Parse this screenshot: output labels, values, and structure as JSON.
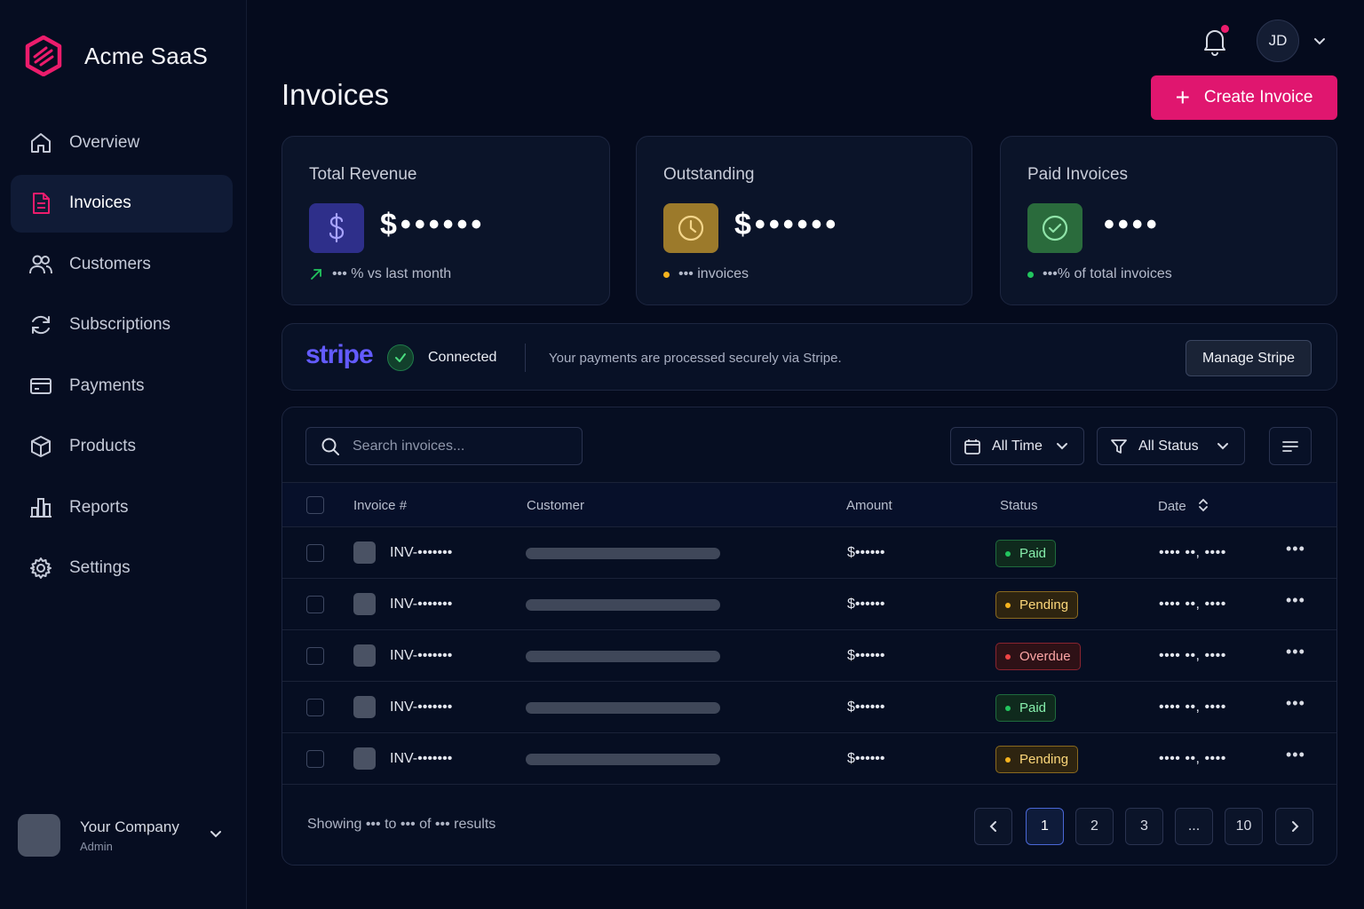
{
  "app": {
    "name": "Acme SaaS"
  },
  "colors": {
    "accent": "#e0166f",
    "paid": "#22c55e",
    "pending": "#f5b31e",
    "overdue": "#ef4444",
    "stripe": "#635bff"
  },
  "sidebar": {
    "items": [
      {
        "label": "Overview",
        "icon": "home-icon"
      },
      {
        "label": "Invoices",
        "icon": "file-icon",
        "active": true
      },
      {
        "label": "Customers",
        "icon": "users-icon"
      },
      {
        "label": "Subscriptions",
        "icon": "refresh-icon"
      },
      {
        "label": "Payments",
        "icon": "credit-card-icon"
      },
      {
        "label": "Products",
        "icon": "box-icon"
      },
      {
        "label": "Reports",
        "icon": "bar-chart-icon"
      },
      {
        "label": "Settings",
        "icon": "gear-icon"
      }
    ],
    "company": {
      "name": "Your Company",
      "role": "Admin"
    }
  },
  "header": {
    "title": "Invoices",
    "avatar_initials": "JD",
    "create_label": "Create Invoice"
  },
  "stats": {
    "revenue": {
      "title": "Total Revenue",
      "value": "$••••••",
      "foot": "••• % vs last month",
      "icon": "dollar-icon"
    },
    "outstanding": {
      "title": "Outstanding",
      "value": "$••••••",
      "foot": "••• invoices",
      "icon": "clock-icon"
    },
    "paid": {
      "title": "Paid Invoices",
      "value": "••••",
      "foot": "•••% of total invoices",
      "icon": "check-circle-icon"
    }
  },
  "stripe": {
    "logo": "stripe",
    "status": "Connected",
    "description": "Your payments are processed securely via Stripe.",
    "manage_label": "Manage Stripe"
  },
  "table": {
    "search_placeholder": "Search invoices...",
    "filters": {
      "time": "All Time",
      "status": "All Status"
    },
    "columns": {
      "invoice": "Invoice #",
      "customer": "Customer",
      "amount": "Amount",
      "status": "Status",
      "date": "Date"
    },
    "rows": [
      {
        "invoice": "INV-•••••••",
        "amount": "$••••••",
        "status": "Paid",
        "date": "•••• ••, ••••"
      },
      {
        "invoice": "INV-•••••••",
        "amount": "$••••••",
        "status": "Pending",
        "date": "•••• ••, ••••"
      },
      {
        "invoice": "INV-•••••••",
        "amount": "$••••••",
        "status": "Overdue",
        "date": "•••• ••, ••••"
      },
      {
        "invoice": "INV-•••••••",
        "amount": "$••••••",
        "status": "Paid",
        "date": "•••• ••, ••••"
      },
      {
        "invoice": "INV-•••••••",
        "amount": "$••••••",
        "status": "Pending",
        "date": "•••• ••, ••••"
      }
    ],
    "more_label": "•••",
    "footer": "Showing ••• to ••• of ••• results",
    "pagination": {
      "pages": [
        "1",
        "2",
        "3",
        "...",
        "10"
      ],
      "current": "1"
    }
  }
}
